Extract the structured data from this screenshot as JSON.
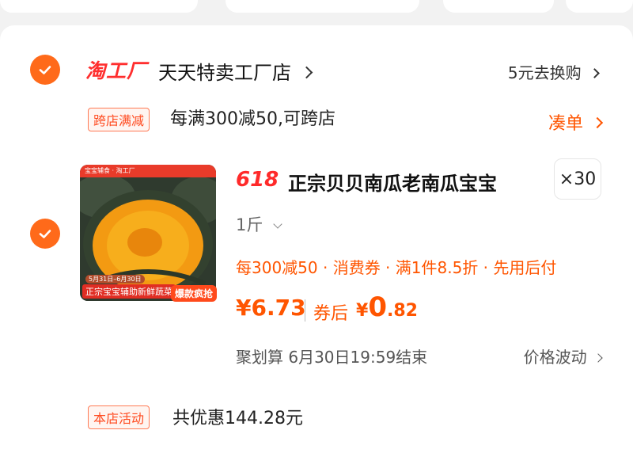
{
  "store": {
    "logo_text": "淘工厂",
    "name": "天天特卖工厂店",
    "swap_link": "5元去换购"
  },
  "promo": {
    "tag": "跨店满减",
    "text": "每满300减50,可跨店",
    "action": "凑单"
  },
  "product": {
    "badge_618": "618",
    "title": "正宗贝贝南瓜老南瓜宝宝",
    "quantity": "×30",
    "spec": "1斤",
    "perks": "每300减50 · 消费券 · 满1件8.5折 · 先用后付",
    "price": "¥6.73",
    "after_coupon_label": "券后",
    "after_price_yen": "¥",
    "after_price_int": "0",
    "after_price_dec": ".82",
    "countdown": "聚划算 6月30日19:59结束",
    "price_wave": "价格波动",
    "thumb": {
      "top_text": "宝宝辅食 · 淘工厂",
      "date_text": "5月31日–6月30日",
      "caption": "正宗宝宝辅助新鲜蔬菜",
      "badge": "爆款疯抢"
    }
  },
  "store_activity": {
    "tag": "本店活动",
    "text": "共优惠144.28元"
  },
  "colors": {
    "accent": "#ff5500",
    "check": "#ff6a1a",
    "logo_red": "#ff2e2e"
  },
  "icons": [
    "check-icon",
    "chevron-right-icon",
    "chevron-down-icon"
  ]
}
